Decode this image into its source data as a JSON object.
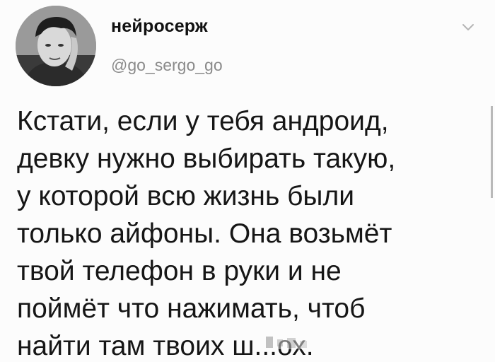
{
  "author": {
    "display_name": "нейросерж",
    "handle": "@go_sergo_go",
    "avatar_icon": "user-avatar"
  },
  "menu": {
    "icon": "chevron-down-icon"
  },
  "tweet": {
    "text": "Кстати, если у тебя андроид,\nдевку нужно выбирать такую,\nу которой всю жизнь были\nтолько айфоны. Она возьмёт\nтвой телефон в руки и не\nпоймёт что нажимать, чтоб\nнайти там твоих ш...ох."
  },
  "colors": {
    "background": "#fcfcfc",
    "text": "#161616",
    "muted": "#8a8a8a"
  }
}
